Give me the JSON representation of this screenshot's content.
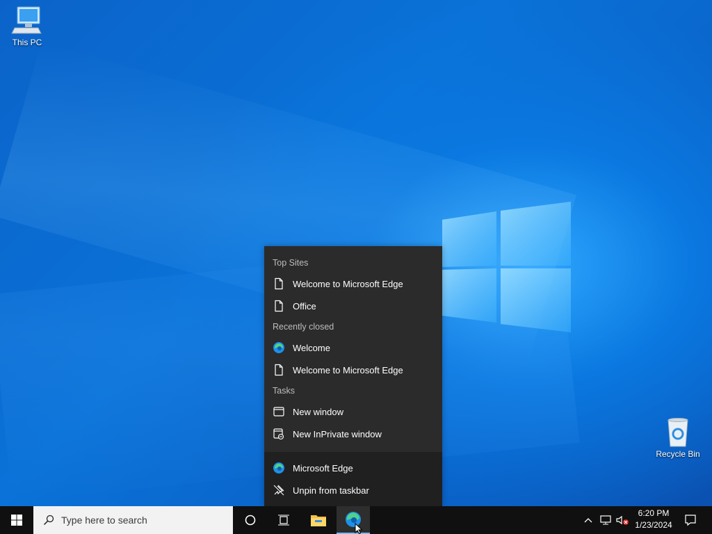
{
  "desktop": {
    "icons": [
      {
        "label": "This PC"
      },
      {
        "label": "Recycle Bin"
      }
    ]
  },
  "jumplist": {
    "sections": [
      {
        "header": "Top Sites",
        "items": [
          {
            "label": "Welcome to Microsoft Edge",
            "icon": "page-icon"
          },
          {
            "label": "Office",
            "icon": "page-icon"
          }
        ]
      },
      {
        "header": "Recently closed",
        "items": [
          {
            "label": "Welcome",
            "icon": "edge-icon"
          },
          {
            "label": "Welcome to Microsoft Edge",
            "icon": "page-icon"
          }
        ]
      },
      {
        "header": "Tasks",
        "items": [
          {
            "label": "New window",
            "icon": "window-icon"
          },
          {
            "label": "New InPrivate window",
            "icon": "inprivate-icon"
          }
        ]
      }
    ],
    "app_items": [
      {
        "label": "Microsoft Edge",
        "icon": "edge-icon"
      },
      {
        "label": "Unpin from taskbar",
        "icon": "unpin-icon"
      }
    ]
  },
  "taskbar": {
    "search_placeholder": "Type here to search",
    "pinned": [
      "cortana-icon",
      "task-view-icon",
      "file-explorer-icon",
      "edge-icon"
    ],
    "active_app": "Microsoft Edge",
    "tray_icons": [
      "chevron-up-icon",
      "network-icon",
      "volume-muted-icon"
    ],
    "clock": {
      "time": "6:20 PM",
      "date": "1/23/2024"
    }
  },
  "colors": {
    "accent": "#0a78e0",
    "jumplist_bg": "#2b2b2b",
    "taskbar_bg": "#101010"
  }
}
